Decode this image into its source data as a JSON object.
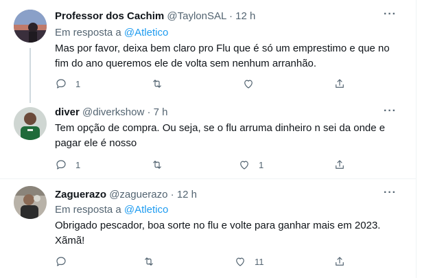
{
  "tweets": [
    {
      "name": "Professor dos Cachim",
      "handle": "@TaylonSAL",
      "dot": "·",
      "time": "12 h",
      "reply_prefix": "Em resposta a",
      "reply_to": "@Atletico",
      "text": "Mas por favor, deixa bem claro pro Flu que é só um emprestimo e que no fim do ano queremos ele de volta sem nenhum arranhão.",
      "replies": "1",
      "retweets": "",
      "likes": ""
    },
    {
      "name": "diver",
      "handle": "@diverkshow",
      "dot": "·",
      "time": "7 h",
      "text": "Tem opção de compra. Ou seja, se o flu arruma dinheiro n sei da onde e pagar ele é nosso",
      "replies": "1",
      "retweets": "",
      "likes": "1"
    },
    {
      "name": "Zaguerazo",
      "handle": "@zaguerazo",
      "dot": "·",
      "time": "12 h",
      "reply_prefix": "Em resposta a",
      "reply_to": "@Atletico",
      "text": "Obrigado pescador, boa sorte no flu e volte para ganhar mais em 2023. Xãmã!",
      "replies": "",
      "retweets": "",
      "likes": "11"
    }
  ],
  "more_glyph": "···",
  "colors": {
    "accent": "#1d9bf0",
    "secondary_text": "#536471",
    "primary_text": "#0f1419",
    "divider": "#eff3f4"
  },
  "icons": [
    "reply-icon",
    "retweet-icon",
    "like-icon",
    "share-icon",
    "more-icon"
  ]
}
